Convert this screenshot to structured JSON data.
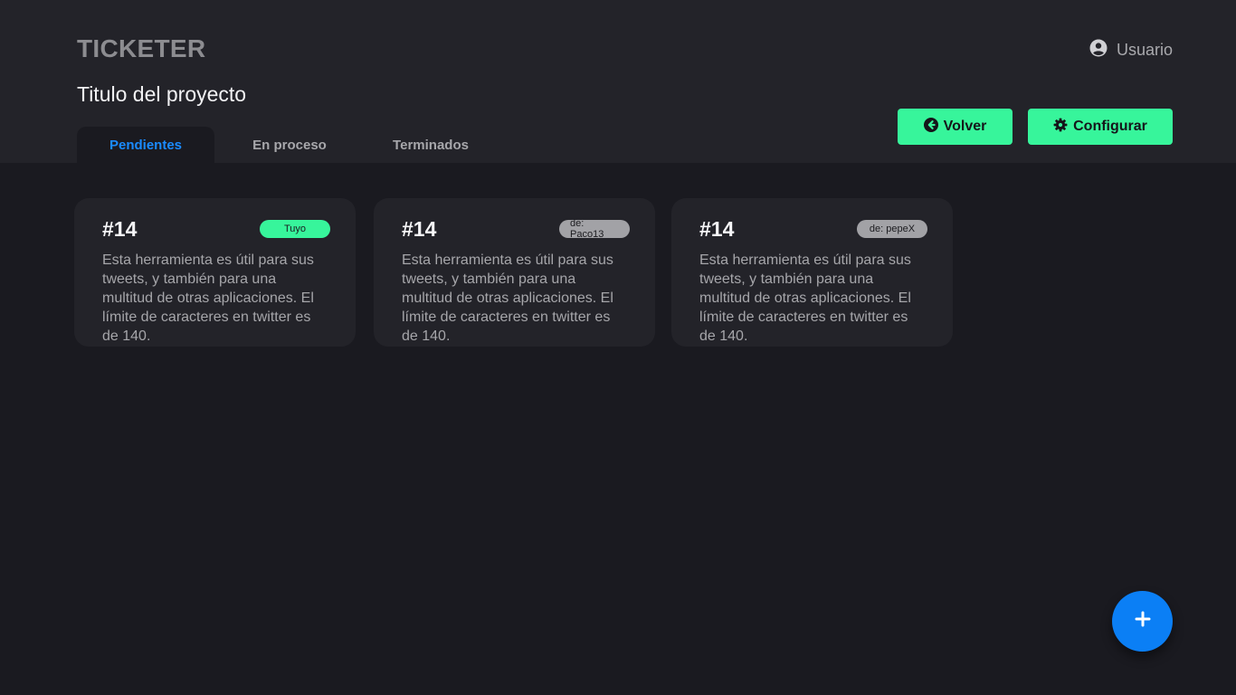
{
  "app": {
    "brand": "TICKETER",
    "user_label": "Usuario",
    "user_icon": "user-circle-icon"
  },
  "project": {
    "title": "Titulo del proyecto"
  },
  "tabs": [
    {
      "label": "Pendientes",
      "active": true
    },
    {
      "label": "En proceso",
      "active": false
    },
    {
      "label": "Terminados",
      "active": false
    }
  ],
  "actions": {
    "back_label": "Volver",
    "back_icon": "arrow-left-circle-icon",
    "config_label": "Configurar",
    "config_icon": "gear-icon"
  },
  "tickets": [
    {
      "number": "#14",
      "badge": "Tuyo",
      "badge_type": "mine",
      "text": "Esta herramienta es útil para sus tweets, y también para una multitud de otras aplicaciones. El límite de caracteres en twitter es de 140."
    },
    {
      "number": "#14",
      "badge": "de: Paco13",
      "badge_type": "other",
      "text": "Esta herramienta es útil para sus tweets, y también para una multitud de otras aplicaciones. El límite de caracteres en twitter es de 140."
    },
    {
      "number": "#14",
      "badge": "de: pepeX",
      "badge_type": "other",
      "text": "Esta herramienta es útil para sus tweets, y también para una multitud de otras aplicaciones. El límite de caracteres en twitter es de 140."
    }
  ],
  "fab": {
    "icon": "plus-icon"
  },
  "colors": {
    "accent_green": "#37f59b",
    "accent_blue": "#0b7ff5",
    "background": "#1a1a20",
    "surface": "#232329"
  }
}
